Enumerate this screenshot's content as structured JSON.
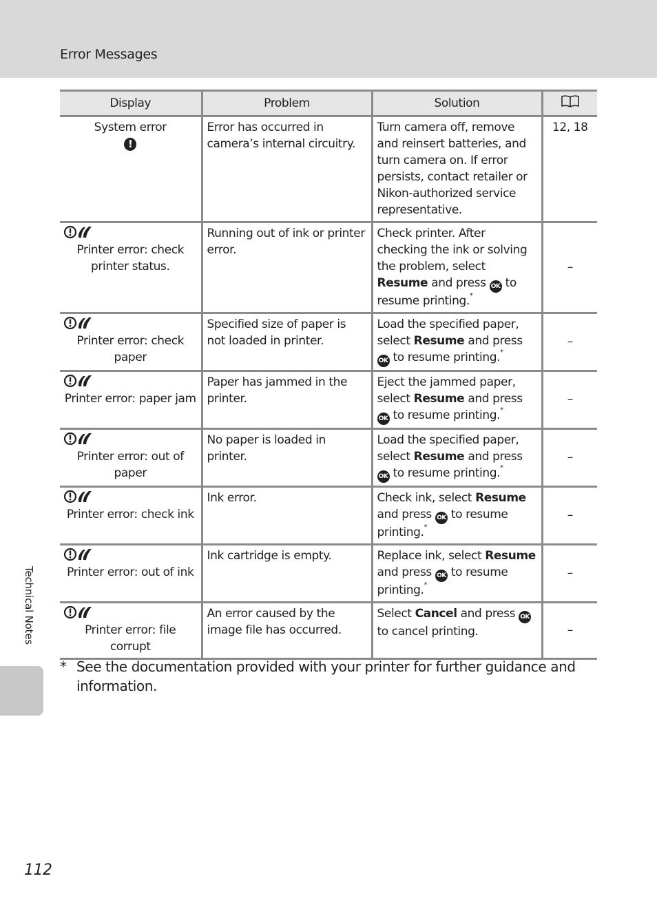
{
  "header": {
    "section_title": "Error Messages"
  },
  "side_tab": {
    "label": "Technical Notes"
  },
  "page_number": "112",
  "table": {
    "columns": {
      "display": "Display",
      "problem": "Problem",
      "solution": "Solution",
      "page_icon": "book-icon"
    },
    "rows": [
      {
        "icon": "exclamation-icon",
        "display": "System error",
        "problem": "Error has occurred in camera’s internal circuitry.",
        "solution": {
          "pre": "Turn camera off, remove and reinsert batteries, and turn camera on. If error persists, contact retailer or Nikon-authorized service representative.",
          "bold": "",
          "mid": "",
          "post": "",
          "asterisk": ""
        },
        "page": "12, 18"
      },
      {
        "icon": "printer-error-icon",
        "display": "Printer error: check printer status.",
        "problem": "Running out of ink or printer error.",
        "solution": {
          "pre": "Check printer. After checking the ink or solving the problem, select ",
          "bold": "Resume",
          "mid": " and press ",
          "ok": "OK",
          "post": " to resume printing.",
          "asterisk": "*"
        },
        "page": "–"
      },
      {
        "icon": "printer-error-icon",
        "display": "Printer error: check paper",
        "problem": "Specified size of paper is not loaded in printer.",
        "solution": {
          "pre": "Load the specified paper, select ",
          "bold": "Resume",
          "mid": " and press ",
          "ok": "OK",
          "post": " to resume printing.",
          "asterisk": "*"
        },
        "page": "–"
      },
      {
        "icon": "printer-error-icon",
        "display": "Printer error: paper jam",
        "problem": "Paper has jammed in the printer.",
        "solution": {
          "pre": "Eject the jammed paper, select ",
          "bold": "Resume",
          "mid": " and press ",
          "ok": "OK",
          "post": " to resume printing.",
          "asterisk": "*"
        },
        "page": "–"
      },
      {
        "icon": "printer-error-icon",
        "display": "Printer error: out of paper",
        "problem": "No paper is loaded in printer.",
        "solution": {
          "pre": "Load the specified paper, select ",
          "bold": "Resume",
          "mid": " and press ",
          "ok": "OK",
          "post": " to resume printing.",
          "asterisk": "*"
        },
        "page": "–"
      },
      {
        "icon": "printer-error-icon",
        "display": "Printer error: check ink",
        "problem": "Ink error.",
        "solution": {
          "pre": "Check ink, select ",
          "bold": "Resume",
          "mid": " and press ",
          "ok": "OK",
          "post": " to resume printing.",
          "asterisk": "*"
        },
        "page": "–"
      },
      {
        "icon": "printer-error-icon",
        "display": "Printer error: out of ink",
        "problem": "Ink cartridge is empty.",
        "solution": {
          "pre": "Replace ink, select ",
          "bold": "Resume",
          "mid": " and press ",
          "ok": "OK",
          "post": " to resume printing.",
          "asterisk": "*"
        },
        "page": "–"
      },
      {
        "icon": "printer-error-icon",
        "display": "Printer error: file corrupt",
        "problem": "An error caused by the image file has occurred.",
        "solution": {
          "pre": "Select ",
          "bold": "Cancel",
          "mid": " and press ",
          "ok": "OK",
          "post": " to cancel printing.",
          "asterisk": ""
        },
        "page": "–"
      }
    ]
  },
  "footnote": {
    "marker": "*",
    "text": "See the documentation provided with your printer for further guidance and information."
  }
}
